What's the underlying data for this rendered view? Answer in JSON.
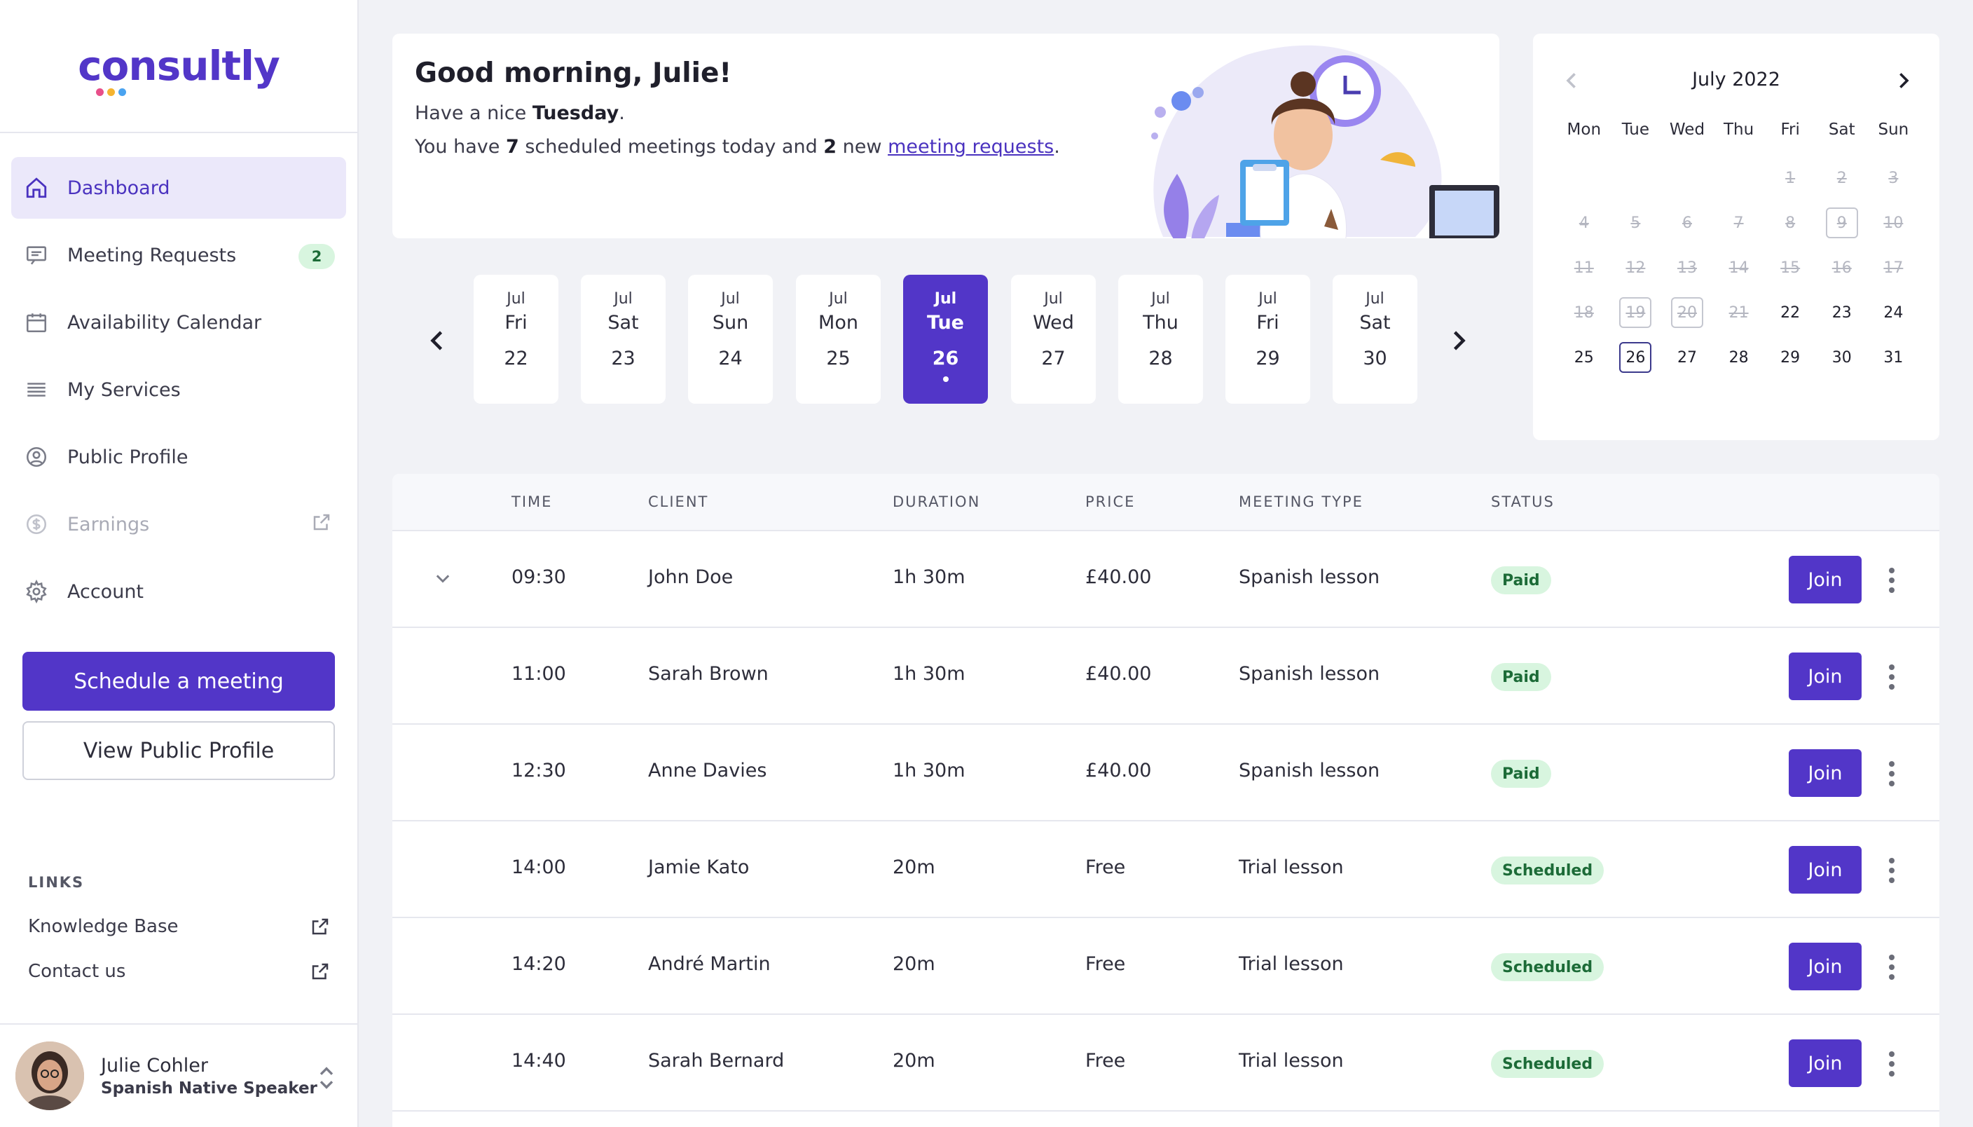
{
  "brand": {
    "logo_text": "consultly",
    "dot_colors": [
      "#e84f8a",
      "#f5b430",
      "#4aa3f0"
    ],
    "accent": "#5236c8"
  },
  "sidebar": {
    "items": [
      {
        "label": "Dashboard",
        "icon": "home-icon",
        "active": true
      },
      {
        "label": "Meeting Requests",
        "icon": "message-icon",
        "badge": "2"
      },
      {
        "label": "Availability Calendar",
        "icon": "calendar-icon"
      },
      {
        "label": "My Services",
        "icon": "list-icon"
      },
      {
        "label": "Public Profile",
        "icon": "user-circle-icon"
      },
      {
        "label": "Earnings",
        "icon": "dollar-icon",
        "disabled": true,
        "external": true
      },
      {
        "label": "Account",
        "icon": "gear-icon"
      }
    ],
    "schedule_button": "Schedule a meeting",
    "view_profile_button": "View Public Profile",
    "links_title": "LINKS",
    "links": [
      {
        "label": "Knowledge Base"
      },
      {
        "label": "Contact us"
      }
    ],
    "user": {
      "name": "Julie Cohler",
      "role": "Spanish Native Speaker"
    }
  },
  "greeting": {
    "title": "Good morning, Julie!",
    "line1_prefix": "Have a nice ",
    "line1_day": "Tuesday",
    "line1_suffix": ".",
    "line2_prefix": "You have ",
    "line2_count": "7",
    "line2_mid": " scheduled meetings today and ",
    "line2_new": "2",
    "line2_mid2": " new ",
    "line2_link": "meeting requests",
    "line2_suffix": "."
  },
  "date_strip": {
    "days": [
      {
        "month": "Jul",
        "dow": "Fri",
        "num": "22"
      },
      {
        "month": "Jul",
        "dow": "Sat",
        "num": "23"
      },
      {
        "month": "Jul",
        "dow": "Sun",
        "num": "24"
      },
      {
        "month": "Jul",
        "dow": "Mon",
        "num": "25"
      },
      {
        "month": "Jul",
        "dow": "Tue",
        "num": "26",
        "active": true
      },
      {
        "month": "Jul",
        "dow": "Wed",
        "num": "27"
      },
      {
        "month": "Jul",
        "dow": "Thu",
        "num": "28"
      },
      {
        "month": "Jul",
        "dow": "Fri",
        "num": "29"
      },
      {
        "month": "Jul",
        "dow": "Sat",
        "num": "30"
      }
    ]
  },
  "calendar": {
    "title": "July 2022",
    "weekdays": [
      "Mon",
      "Tue",
      "Wed",
      "Thu",
      "Fri",
      "Sat",
      "Sun"
    ],
    "cells": [
      {
        "d": ""
      },
      {
        "d": ""
      },
      {
        "d": ""
      },
      {
        "d": ""
      },
      {
        "d": "1",
        "s": "past"
      },
      {
        "d": "2",
        "s": "past"
      },
      {
        "d": "3",
        "s": "past"
      },
      {
        "d": "4",
        "s": "past"
      },
      {
        "d": "5",
        "s": "past"
      },
      {
        "d": "6",
        "s": "past"
      },
      {
        "d": "7",
        "s": "past"
      },
      {
        "d": "8",
        "s": "past"
      },
      {
        "d": "9",
        "s": "past boxed"
      },
      {
        "d": "10",
        "s": "past"
      },
      {
        "d": "11",
        "s": "past"
      },
      {
        "d": "12",
        "s": "past"
      },
      {
        "d": "13",
        "s": "past"
      },
      {
        "d": "14",
        "s": "past"
      },
      {
        "d": "15",
        "s": "past"
      },
      {
        "d": "16",
        "s": "past"
      },
      {
        "d": "17",
        "s": "past"
      },
      {
        "d": "18",
        "s": "past"
      },
      {
        "d": "19",
        "s": "past boxed"
      },
      {
        "d": "20",
        "s": "past boxed"
      },
      {
        "d": "21",
        "s": "past"
      },
      {
        "d": "22",
        "s": "future"
      },
      {
        "d": "23",
        "s": "future"
      },
      {
        "d": "24",
        "s": "future"
      },
      {
        "d": "25",
        "s": "future"
      },
      {
        "d": "26",
        "s": "today"
      },
      {
        "d": "27",
        "s": "future"
      },
      {
        "d": "28",
        "s": "future"
      },
      {
        "d": "29",
        "s": "future"
      },
      {
        "d": "30",
        "s": "future"
      },
      {
        "d": "31",
        "s": "future"
      }
    ]
  },
  "meetings": {
    "headers": [
      "TIME",
      "CLIENT",
      "DURATION",
      "PRICE",
      "MEETING TYPE",
      "STATUS"
    ],
    "join_label": "Join",
    "rows": [
      {
        "time": "09:30",
        "client": "John Doe",
        "duration": "1h 30m",
        "price": "£40.00",
        "type": "Spanish lesson",
        "status": "Paid",
        "expandable": true
      },
      {
        "time": "11:00",
        "client": "Sarah Brown",
        "duration": "1h 30m",
        "price": "£40.00",
        "type": "Spanish lesson",
        "status": "Paid"
      },
      {
        "time": "12:30",
        "client": "Anne Davies",
        "duration": "1h 30m",
        "price": "£40.00",
        "type": "Spanish lesson",
        "status": "Paid"
      },
      {
        "time": "14:00",
        "client": "Jamie Kato",
        "duration": "20m",
        "price": "Free",
        "type": "Trial lesson",
        "status": "Scheduled"
      },
      {
        "time": "14:20",
        "client": "André Martin",
        "duration": "20m",
        "price": "Free",
        "type": "Trial lesson",
        "status": "Scheduled"
      },
      {
        "time": "14:40",
        "client": "Sarah Bernard",
        "duration": "20m",
        "price": "Free",
        "type": "Trial lesson",
        "status": "Scheduled"
      }
    ]
  }
}
